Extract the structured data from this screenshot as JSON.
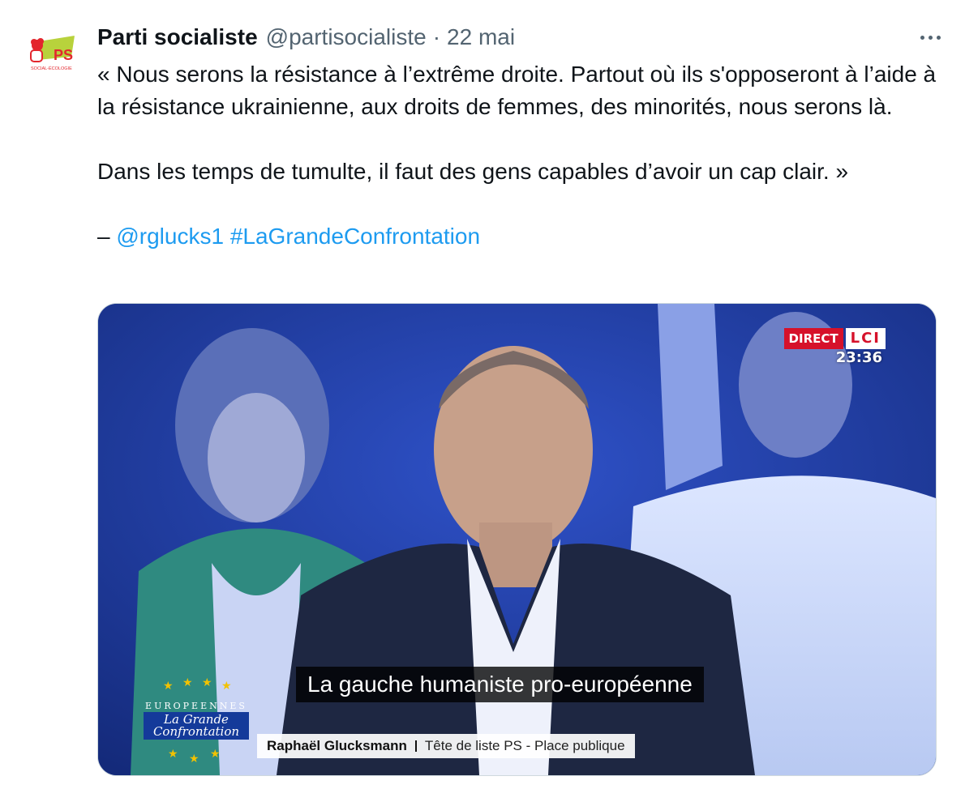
{
  "author": {
    "name": "Parti socialiste",
    "handle": "@partisocialiste",
    "separator": "·",
    "date": "22 mai",
    "avatar_label": "PS",
    "avatar_sublabel": "SOCIAL-ÉCOLOGIE"
  },
  "more_menu": {
    "icon": "more-horizontal-icon"
  },
  "tweet": {
    "paragraph1": "« Nous serons la résistance à l’extrême droite. Partout où ils s'opposeront à l’aide à la résistance ukrainienne, aux droits de femmes, des minorités, nous serons là.",
    "paragraph2": "Dans les temps de tumulte, il faut des gens capables d’avoir un cap clair. »",
    "signature_prefix": "– ",
    "mention": "@rglucks1",
    "hashtag": "#LaGrandeConfrontation"
  },
  "media": {
    "live_badge": "DIRECT",
    "channel": "LCI",
    "clock": "23:36",
    "subtitle": "La gauche humaniste pro-européenne",
    "show_title_top": "EUROPEENNES",
    "show_title_line1": "La Grande",
    "show_title_line2": "Confrontation",
    "speaker_name": "Raphaël Glucksmann",
    "speaker_role": "Tête de liste PS - Place publique"
  },
  "colors": {
    "link": "#1d9bf0",
    "secondary_text": "#536471",
    "lci_red": "#d6112a"
  }
}
